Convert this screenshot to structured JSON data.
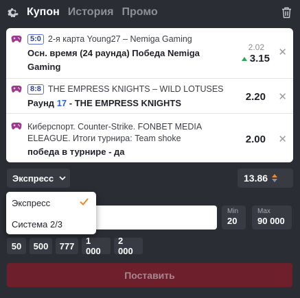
{
  "header": {
    "tabs": [
      {
        "label": "Купон",
        "active": true
      },
      {
        "label": "История",
        "active": false
      },
      {
        "label": "Промо",
        "active": false
      }
    ],
    "icons": {
      "settings": "gear-icon",
      "clear": "trash-icon"
    }
  },
  "bets": [
    {
      "score": "5:0",
      "event": "2-я карта Young27 – Nemiga Gaming",
      "outcome": "Осн. время (24 раунда) Победа Nemiga Gaming",
      "old_odd": "2.02",
      "odd": "3.15",
      "trend": "up"
    },
    {
      "score": "8:8",
      "event": "THE EMPRESS KNIGHTS – WILD LOTUSES",
      "outcome_prefix": "Раунд",
      "outcome_round": "17",
      "outcome_suffix": "- THE EMPRESS KNIGHTS",
      "odd": "2.20"
    },
    {
      "event": "Киберспорт. Counter-Strike. FONBET MEDIA ELEAGUE. Итоги турнира: Team shoke",
      "outcome": "победа в турнире - да",
      "odd": "2.00"
    }
  ],
  "bet_type": {
    "selected": "Экспресс",
    "options": [
      "Экспресс",
      "Система 2/3"
    ]
  },
  "total_odd": "13.86",
  "stake": {
    "value": "",
    "min_label": "Min",
    "min_value": "20",
    "max_label": "Max",
    "max_value": "90 000"
  },
  "quick_amounts": [
    "50",
    "500",
    "777",
    "1 000",
    "2 000"
  ],
  "place_button": "Поставить",
  "colors": {
    "background": "#2a2d34",
    "accent_orange": "#f08a24",
    "odd_up": "#2aa853",
    "place_button": "#6e1f2c"
  }
}
